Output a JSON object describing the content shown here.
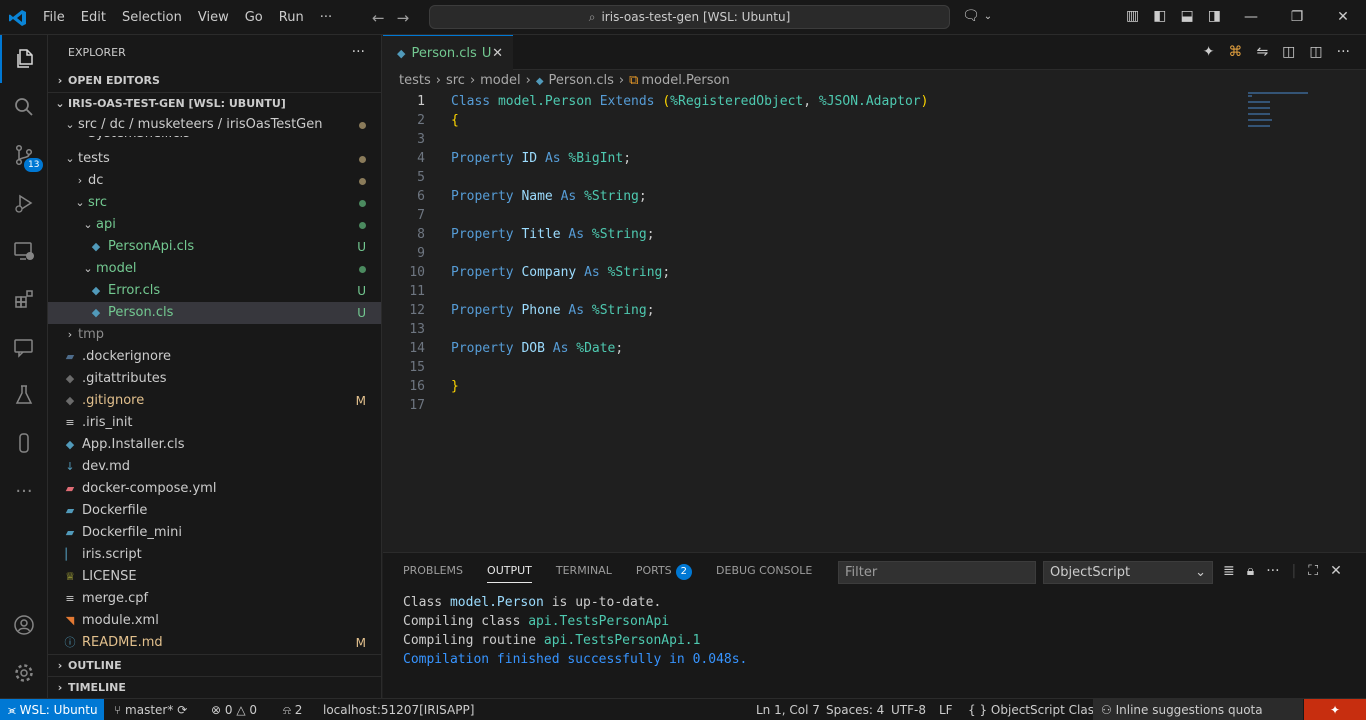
{
  "menu": [
    "File",
    "Edit",
    "Selection",
    "View",
    "Go",
    "Run",
    "···"
  ],
  "command_center": "iris-oas-test-gen [WSL: Ubuntu]",
  "activity": {
    "source_control_badge": "13"
  },
  "explorer": {
    "title": "EXPLORER",
    "sections": {
      "open_editors": "OPEN EDITORS",
      "workspace": "IRIS-OAS-TEST-GEN [WSL: UBUNTU]",
      "outline": "OUTLINE",
      "timeline": "TIMELINE"
    },
    "sticky_path": "src / dc / musketeers / irisOasTestGen",
    "items": [
      {
        "label": "SystemShell.cls"
      },
      {
        "label": "tests"
      },
      {
        "label": "dc"
      },
      {
        "label": "src"
      },
      {
        "label": "api"
      },
      {
        "label": "PersonApi.cls",
        "status": "U"
      },
      {
        "label": "model"
      },
      {
        "label": "Error.cls",
        "status": "U"
      },
      {
        "label": "Person.cls",
        "status": "U"
      },
      {
        "label": "tmp"
      },
      {
        "label": ".dockerignore"
      },
      {
        "label": ".gitattributes"
      },
      {
        "label": ".gitignore",
        "status": "M"
      },
      {
        "label": ".iris_init"
      },
      {
        "label": "App.Installer.cls"
      },
      {
        "label": "dev.md"
      },
      {
        "label": "docker-compose.yml"
      },
      {
        "label": "Dockerfile"
      },
      {
        "label": "Dockerfile_mini"
      },
      {
        "label": "iris.script"
      },
      {
        "label": "LICENSE"
      },
      {
        "label": "merge.cpf"
      },
      {
        "label": "module.xml"
      },
      {
        "label": "README.md",
        "status": "M"
      }
    ]
  },
  "tab": {
    "label": "Person.cls",
    "status": "U"
  },
  "breadcrumbs": [
    "tests",
    "src",
    "model",
    "Person.cls",
    "model.Person"
  ],
  "code": {
    "line_numbers": [
      "1",
      "2",
      "3",
      "4",
      "5",
      "6",
      "7",
      "8",
      "9",
      "10",
      "11",
      "12",
      "13",
      "14",
      "15",
      "16",
      "17"
    ],
    "class_kw": "Class",
    "class_name": "model.Person",
    "extends_kw": "Extends",
    "paren_open": "(",
    "base1": "%RegisteredObject",
    "comma": ", ",
    "base2": "%JSON.Adaptor",
    "paren_close": ")",
    "brace_open": "{",
    "brace_close": "}",
    "property_kw": "Property",
    "as_kw": "As",
    "properties": [
      {
        "name": "ID",
        "type": "%BigInt"
      },
      {
        "name": "Name",
        "type": "%String"
      },
      {
        "name": "Title",
        "type": "%String"
      },
      {
        "name": "Company",
        "type": "%String"
      },
      {
        "name": "Phone",
        "type": "%String"
      },
      {
        "name": "DOB",
        "type": "%Date"
      }
    ]
  },
  "panel": {
    "tabs": [
      "PROBLEMS",
      "OUTPUT",
      "TERMINAL",
      "PORTS",
      "DEBUG CONSOLE"
    ],
    "ports_badge": "2",
    "filter_placeholder": "Filter",
    "channel": "ObjectScript",
    "output": {
      "l1_a": "Class ",
      "l1_b": "model.Person",
      "l1_c": " is up-to-date.",
      "l2_a": "Compiling class ",
      "l2_b": "api.TestsPersonApi",
      "l3_a": "Compiling routine ",
      "l3_b": "api.TestsPersonApi.1",
      "l4": "Compilation finished successfully in 0.048s."
    }
  },
  "status": {
    "remote": "WSL: Ubuntu",
    "branch": "master*",
    "errors": "0",
    "warnings": "0",
    "ports": "2",
    "server": "localhost:51207[IRISAPP]",
    "position": "Ln 1, Col 7",
    "spaces": "Spaces: 4",
    "encoding": "UTF-8",
    "eol": "LF",
    "language": "ObjectScript Class",
    "quota": "Inline suggestions quota reached"
  },
  "colors": {
    "accent": "#0078d4",
    "untracked": "#73c991",
    "modified": "#e2c08d",
    "copilot": "#c72e0f"
  }
}
